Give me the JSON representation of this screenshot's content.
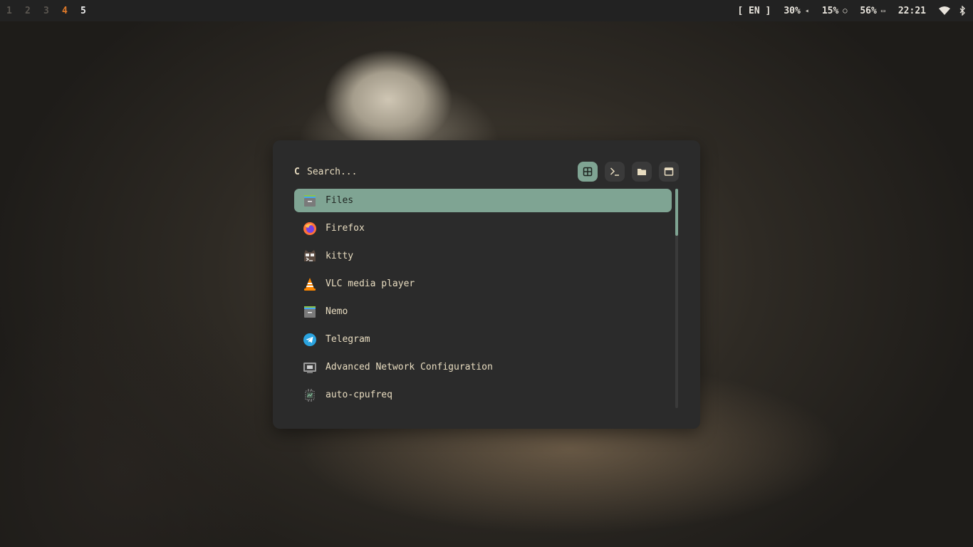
{
  "workspaces": [
    {
      "label": "1"
    },
    {
      "label": "2"
    },
    {
      "label": "3"
    },
    {
      "label": "4"
    },
    {
      "label": "5"
    }
  ],
  "status": {
    "keyboard_layout": "[ EN ]",
    "volume": "30%",
    "volume_icon": "speaker-icon",
    "brightness": "15%",
    "brightness_icon": "brightness-icon",
    "battery": "56%",
    "battery_icon": "battery-icon",
    "clock": "22:21"
  },
  "launcher": {
    "search_placeholder": "Search...",
    "search_value": "",
    "modes": [
      {
        "name": "apps-mode-button",
        "icon": "grid-icon",
        "active": true
      },
      {
        "name": "terminal-mode-button",
        "icon": "terminal-icon",
        "active": false
      },
      {
        "name": "files-mode-button",
        "icon": "folder-icon",
        "active": false
      },
      {
        "name": "windows-mode-button",
        "icon": "window-icon",
        "active": false
      }
    ],
    "apps": [
      {
        "label": "Files",
        "icon": "files-icon",
        "selected": true
      },
      {
        "label": "Firefox",
        "icon": "firefox-icon",
        "selected": false
      },
      {
        "label": "kitty",
        "icon": "kitty-icon",
        "selected": false
      },
      {
        "label": "VLC media player",
        "icon": "vlc-icon",
        "selected": false
      },
      {
        "label": "Nemo",
        "icon": "nemo-icon",
        "selected": false
      },
      {
        "label": "Telegram",
        "icon": "telegram-icon",
        "selected": false
      },
      {
        "label": "Advanced Network Configuration",
        "icon": "network-icon",
        "selected": false
      },
      {
        "label": "auto-cpufreq",
        "icon": "cpufreq-icon",
        "selected": false
      }
    ]
  },
  "colors": {
    "accent": "#7fa493",
    "active_workspace": "#e07a2a",
    "launcher_bg": "#2b2b2b",
    "text": "#e8dcc0"
  }
}
